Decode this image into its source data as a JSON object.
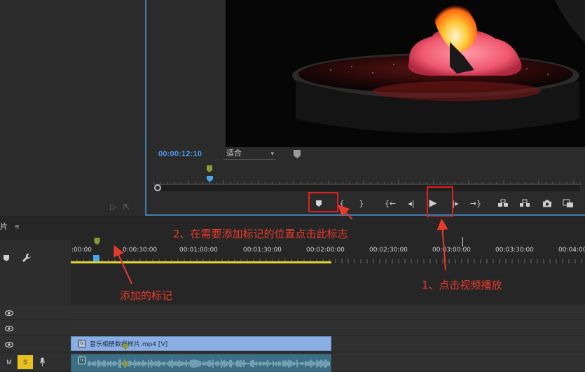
{
  "monitor": {
    "timecode": "00:00:12:10",
    "fit_label": "适合"
  },
  "controls": [
    {
      "name": "add-marker-button",
      "glyph": "marker"
    },
    {
      "name": "mark-in-button",
      "glyph": "{"
    },
    {
      "name": "mark-out-button",
      "glyph": "}"
    },
    {
      "name": "go-to-in-button",
      "glyph": "{←"
    },
    {
      "name": "step-back-button",
      "glyph": "◂|"
    },
    {
      "name": "play-button",
      "glyph": "▶"
    },
    {
      "name": "step-forward-button",
      "glyph": "|▸"
    },
    {
      "name": "go-to-out-button",
      "glyph": "→}"
    },
    {
      "name": "lift-button",
      "glyph": "lift"
    },
    {
      "name": "extract-button",
      "glyph": "extract"
    },
    {
      "name": "export-frame-button",
      "glyph": "camera"
    },
    {
      "name": "compare-view-button",
      "glyph": "compare"
    }
  ],
  "timeline": {
    "panel_title": "片",
    "menu_glyph": "≡",
    "ticks": [
      ":00:00",
      "0:00:30:00",
      "00:01:00:00",
      "00:01:30:00",
      "00:02:00:00",
      "00:02:30:00",
      "00:03:00:00",
      "00:03:30:00",
      "00:04:00"
    ],
    "video_clip_name": "音乐相册数据样片.mp4 [V]",
    "fx_label": "fx",
    "mute_label": "M",
    "solo_label": "S"
  },
  "annotations": {
    "step1": "1、点击视频播放",
    "step2": "2、在需要添加标记的位置点击此标志",
    "added_marker": "添加的标记"
  },
  "colors": {
    "annotation": "#e83a2c",
    "timecode": "#4d9bea",
    "marker": "#8a9a3a",
    "playhead": "#4aa6e8",
    "work_area": "#e0d230",
    "video_clip": "#8ab0e3",
    "audio_clip": "#3c6f85",
    "solo_active": "#e8c11e"
  }
}
